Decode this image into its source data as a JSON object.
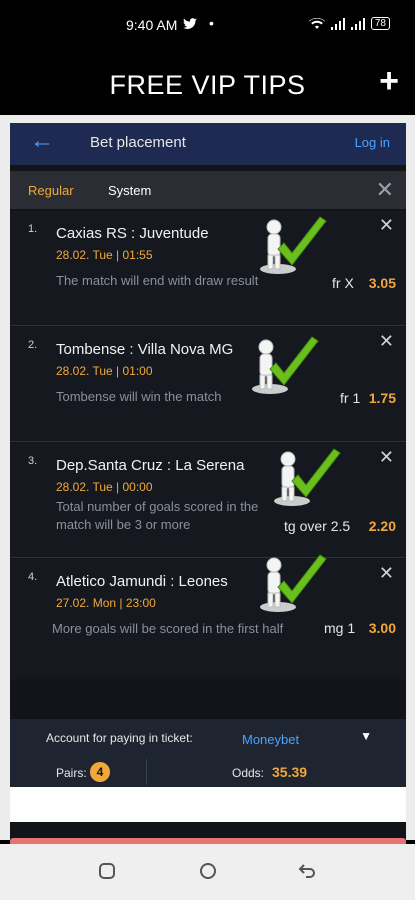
{
  "status": {
    "time": "9:40 AM",
    "twitter_glyph": "🐦",
    "dot": "•",
    "right_text": "📶 🔋",
    "battery": "78"
  },
  "app": {
    "title": "FREE VIP TIPS",
    "plus": "+"
  },
  "bet_panel": {
    "back_icon": "←",
    "title": "Bet placement",
    "login": "Log in",
    "tabs": [
      {
        "label": "Regular",
        "active": true
      },
      {
        "label": "System",
        "active": false
      }
    ],
    "close_all": "✕"
  },
  "bets": [
    {
      "num": "1.",
      "match": "Caxias RS : Juventude",
      "date": "28.02. Tue | 01:55",
      "desc": "The match will end with draw result",
      "market": "fr X",
      "odd": "3.05"
    },
    {
      "num": "2.",
      "match": "Tombense : Villa Nova MG",
      "date": "28.02. Tue | 01:00",
      "desc": "Tombense will win the match",
      "market": "fr 1",
      "odd": "1.75"
    },
    {
      "num": "3.",
      "match": "Dep.Santa Cruz : La Serena",
      "date": "28.02. Tue | 00:00",
      "desc": "Total number of goals scored in the match will be 3 or more",
      "market": "tg over 2.5",
      "odd": "2.20"
    },
    {
      "num": "4.",
      "match": "Atletico Jamundi : Leones",
      "date": "27.02. Mon | 23:00",
      "desc": "More goals will be scored in the first half",
      "market": "mg 1",
      "odd": "3.00"
    }
  ],
  "footer": {
    "account_label": "Account for paying in ticket:",
    "account_value": "Moneybet",
    "caret": "▼",
    "pairs_label": "Pairs:",
    "pairs_count": "4",
    "odds_label": "Odds:",
    "odds_value": "35.39"
  },
  "nav": {
    "recents": "▢",
    "home": "○",
    "back": "↩"
  },
  "colors": {
    "accent_orange": "#f1a83b",
    "link_blue": "#4aa3ff",
    "check_green": "#6abf1e"
  }
}
